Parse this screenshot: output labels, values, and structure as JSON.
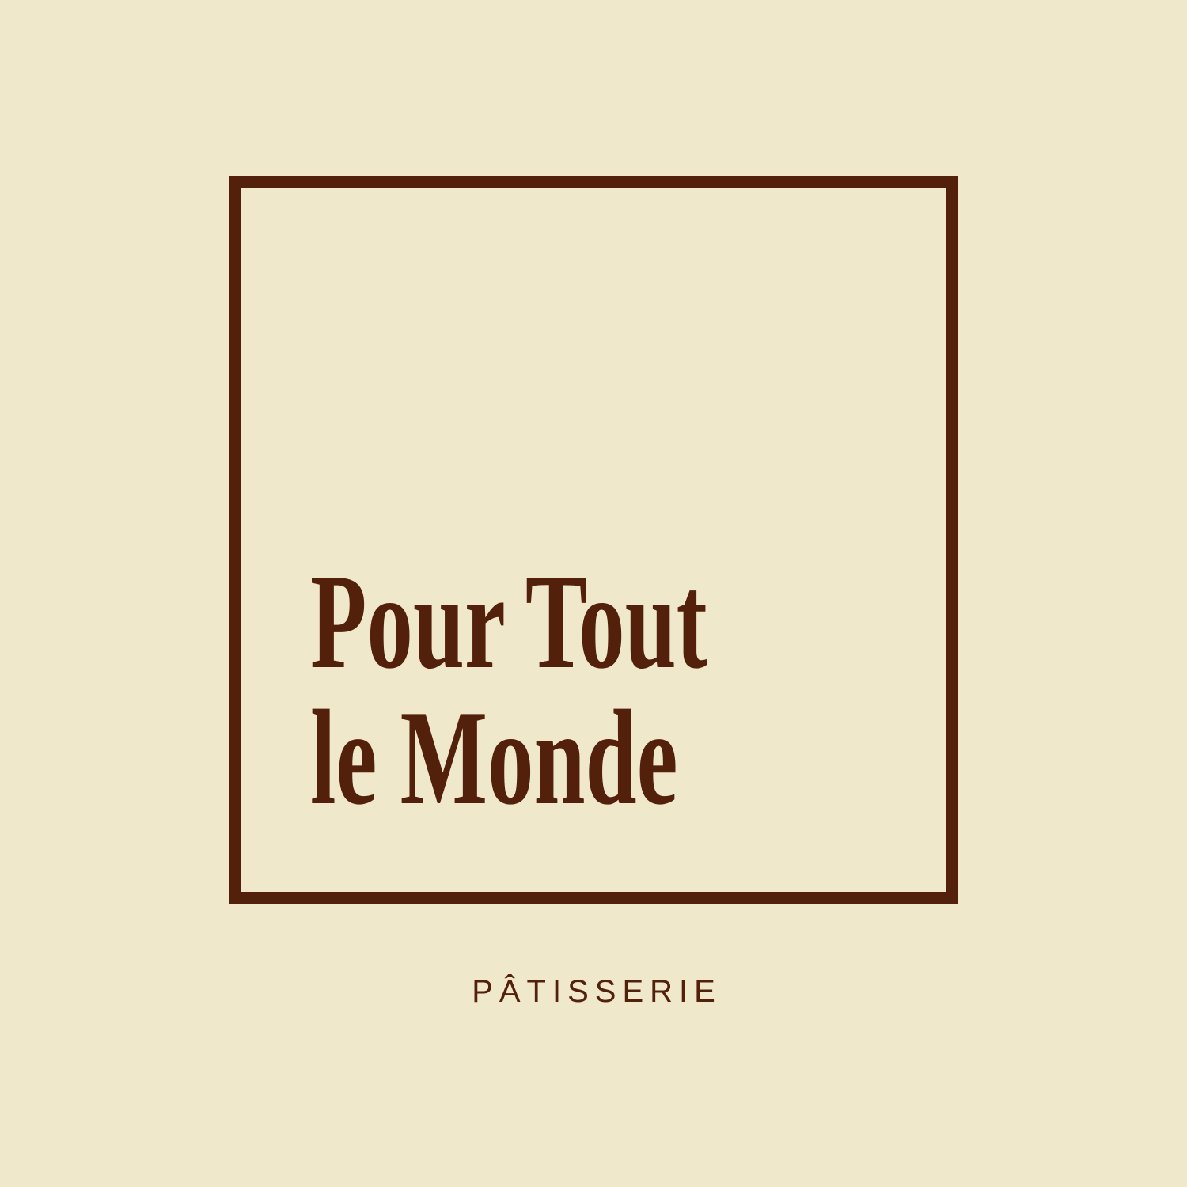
{
  "logo": {
    "name_line_1": "Pour Tout",
    "name_line_2": "le Monde",
    "tagline": "PÂTISSERIE"
  },
  "colors": {
    "background": "#efe8cb",
    "brand": "#52200b"
  }
}
